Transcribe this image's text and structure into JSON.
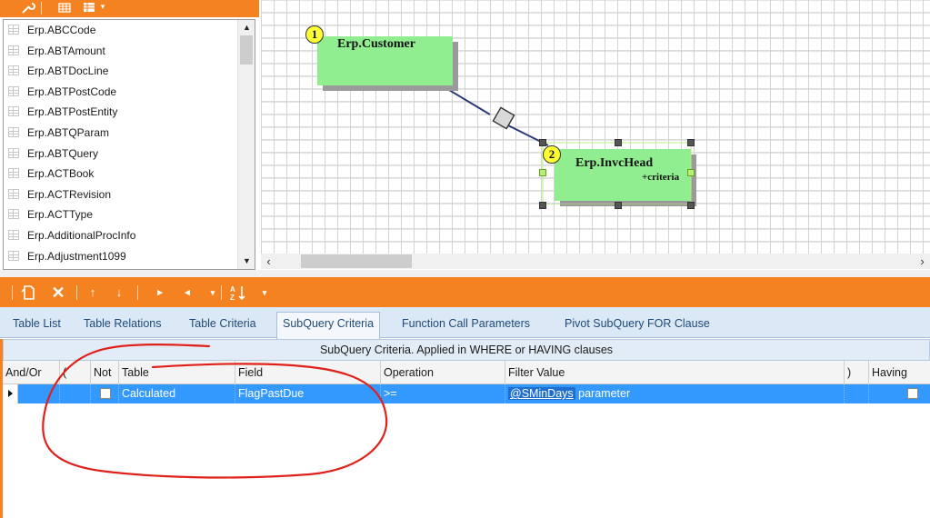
{
  "table_list": {
    "items": [
      "Erp.ABCCode",
      "Erp.ABTAmount",
      "Erp.ABTDocLine",
      "Erp.ABTPostCode",
      "Erp.ABTPostEntity",
      "Erp.ABTQParam",
      "Erp.ABTQuery",
      "Erp.ACTBook",
      "Erp.ACTRevision",
      "Erp.ACTType",
      "Erp.AdditionalProcInfo",
      "Erp.Adjustment1099"
    ]
  },
  "diagram": {
    "nodes": [
      {
        "badge": "1",
        "name": "Erp.Customer",
        "sub": ""
      },
      {
        "badge": "2",
        "name": "Erp.InvcHead",
        "sub": "+criteria"
      }
    ],
    "colors": {
      "node_fill": "#90ee90",
      "badge_fill": "#ffff33",
      "link": "#2e3a78"
    }
  },
  "tabs": [
    {
      "label": "Table List",
      "active": false
    },
    {
      "label": "Table Relations",
      "active": false
    },
    {
      "label": "Table Criteria",
      "active": false
    },
    {
      "label": "SubQuery Criteria",
      "active": true
    },
    {
      "label": "Function Call Parameters",
      "active": false
    },
    {
      "label": "Pivot SubQuery FOR Clause",
      "active": false
    }
  ],
  "grid": {
    "caption": "SubQuery Criteria. Applied in WHERE or HAVING clauses",
    "columns": {
      "and_or": "And/Or",
      "open_paren": "(",
      "not": "Not",
      "table": "Table",
      "field": "Field",
      "operation": "Operation",
      "filter_value": "Filter Value",
      "close_paren": ")",
      "having": "Having"
    },
    "rows": [
      {
        "and_or": "",
        "open_paren": "",
        "not": false,
        "table": "Calculated",
        "field": "FlagPastDue",
        "operation": ">=",
        "filter_value_link": "@SMinDays",
        "filter_value_suffix": "parameter",
        "close_paren": "",
        "having": false
      }
    ]
  },
  "toolbar_icons": {
    "left": [
      "wrench-icon",
      "grid-icon",
      "table-dropdown-icon"
    ],
    "bottom": [
      "new-icon",
      "delete-icon",
      "move-up-icon",
      "move-down-icon",
      "next-icon",
      "previous-icon",
      "sort-az-icon"
    ]
  },
  "colors": {
    "accent": "#f58220",
    "selection": "#3399ff",
    "tab_bg": "#dbe8f5",
    "annotation": "#e0201b"
  }
}
